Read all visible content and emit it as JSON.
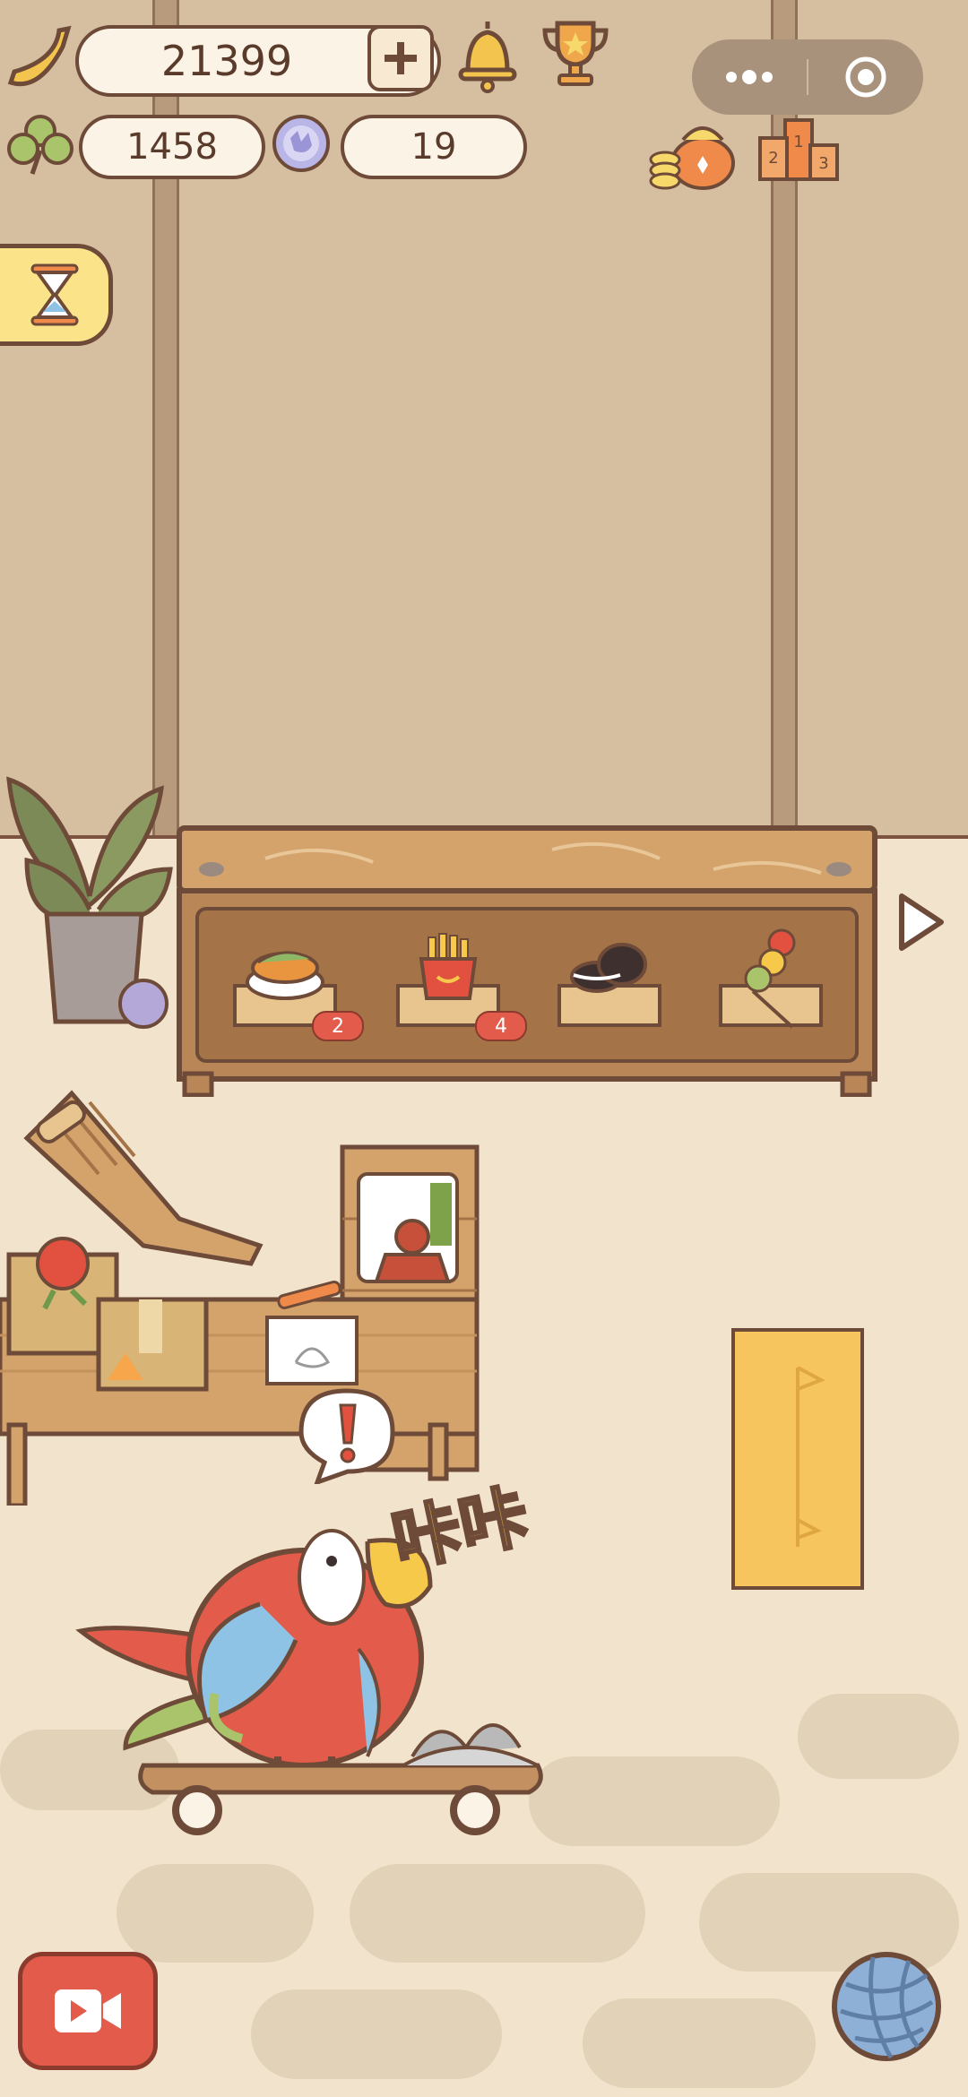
{
  "currencies": {
    "bananas": "21399",
    "clovers": "1458",
    "gems": "19"
  },
  "shelf": {
    "items": [
      {
        "name": "fried-fish-plate",
        "count": "2"
      },
      {
        "name": "french-fries",
        "count": "4"
      },
      {
        "name": "cookies",
        "count": ""
      },
      {
        "name": "candy-skewer",
        "count": ""
      }
    ]
  },
  "parrot_speech": "咔咔",
  "colors": {
    "wall": "#d6bfa0",
    "floor": "#f2e4cc",
    "accent_red": "#e25b4b",
    "outline": "#6e4a38"
  }
}
